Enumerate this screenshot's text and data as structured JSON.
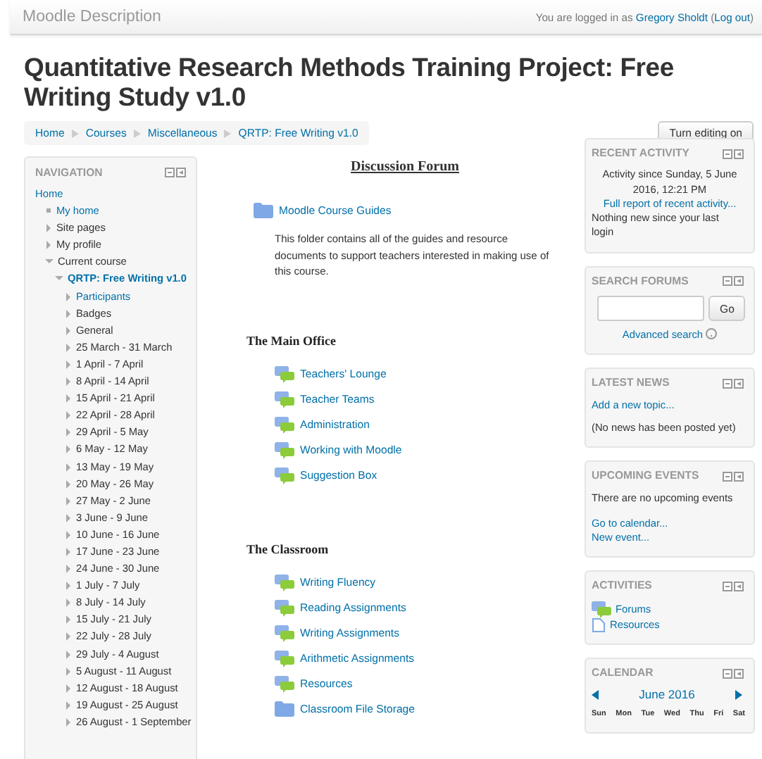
{
  "header": {
    "site_name": "Moodle Description",
    "login": {
      "before": "You are logged in as ",
      "user": "Gregory Sholdt",
      "middle": " (",
      "logout": "Log out",
      "after": ")"
    }
  },
  "title": "Quantitative Research Methods Training Project: Free Writing Study v1.0",
  "breadcrumb": [
    "Home",
    "Courses",
    "Miscellaneous",
    "QRTP: Free Writing v1.0"
  ],
  "edit_button": "Turn editing on",
  "navigation": {
    "title": "NAVIGATION",
    "items": [
      {
        "label": "Home",
        "link": true,
        "selected": false,
        "children": [
          {
            "label": "My home",
            "kind": "leaf",
            "link": true,
            "selected": false
          },
          {
            "label": "Site pages",
            "kind": "branch",
            "expanded": false,
            "link": false,
            "selected": false
          },
          {
            "label": "My profile",
            "kind": "branch",
            "expanded": false,
            "link": false,
            "selected": false
          },
          {
            "label": "Current course",
            "kind": "branch",
            "expanded": true,
            "link": false,
            "selected": false,
            "children": [
              {
                "label": "QRTP: Free Writing v1.0",
                "kind": "branch",
                "expanded": true,
                "link": true,
                "selected": true,
                "children": [
                  {
                    "label": "Participants",
                    "kind": "branch",
                    "expanded": false,
                    "link": true,
                    "selected": false
                  },
                  {
                    "label": "Badges",
                    "kind": "branch",
                    "expanded": false,
                    "link": false,
                    "selected": false
                  },
                  {
                    "label": "General",
                    "kind": "branch",
                    "expanded": false,
                    "link": false,
                    "selected": false
                  },
                  {
                    "label": "25 March - 31 March",
                    "kind": "branch",
                    "expanded": false,
                    "link": false,
                    "selected": false
                  },
                  {
                    "label": "1 April - 7 April",
                    "kind": "branch",
                    "expanded": false,
                    "link": false,
                    "selected": false
                  },
                  {
                    "label": "8 April - 14 April",
                    "kind": "branch",
                    "expanded": false,
                    "link": false,
                    "selected": false
                  },
                  {
                    "label": "15 April - 21 April",
                    "kind": "branch",
                    "expanded": false,
                    "link": false,
                    "selected": false
                  },
                  {
                    "label": "22 April - 28 April",
                    "kind": "branch",
                    "expanded": false,
                    "link": false,
                    "selected": false
                  },
                  {
                    "label": "29 April - 5 May",
                    "kind": "branch",
                    "expanded": false,
                    "link": false,
                    "selected": false
                  },
                  {
                    "label": "6 May - 12 May",
                    "kind": "branch",
                    "expanded": false,
                    "link": false,
                    "selected": false
                  },
                  {
                    "label": "13 May - 19 May",
                    "kind": "branch",
                    "expanded": false,
                    "link": false,
                    "selected": false
                  },
                  {
                    "label": "20 May - 26 May",
                    "kind": "branch",
                    "expanded": false,
                    "link": false,
                    "selected": false
                  },
                  {
                    "label": "27 May - 2 June",
                    "kind": "branch",
                    "expanded": false,
                    "link": false,
                    "selected": false
                  },
                  {
                    "label": "3 June - 9 June",
                    "kind": "branch",
                    "expanded": false,
                    "link": false,
                    "selected": false
                  },
                  {
                    "label": "10 June - 16 June",
                    "kind": "branch",
                    "expanded": false,
                    "link": false,
                    "selected": false
                  },
                  {
                    "label": "17 June - 23 June",
                    "kind": "branch",
                    "expanded": false,
                    "link": false,
                    "selected": false
                  },
                  {
                    "label": "24 June - 30 June",
                    "kind": "branch",
                    "expanded": false,
                    "link": false,
                    "selected": false
                  },
                  {
                    "label": "1 July - 7 July",
                    "kind": "branch",
                    "expanded": false,
                    "link": false,
                    "selected": false
                  },
                  {
                    "label": "8 July - 14 July",
                    "kind": "branch",
                    "expanded": false,
                    "link": false,
                    "selected": false
                  },
                  {
                    "label": "15 July - 21 July",
                    "kind": "branch",
                    "expanded": false,
                    "link": false,
                    "selected": false
                  },
                  {
                    "label": "22 July - 28 July",
                    "kind": "branch",
                    "expanded": false,
                    "link": false,
                    "selected": false
                  },
                  {
                    "label": "29 July - 4 August",
                    "kind": "branch",
                    "expanded": false,
                    "link": false,
                    "selected": false
                  },
                  {
                    "label": "5 August - 11 August",
                    "kind": "branch",
                    "expanded": false,
                    "link": false,
                    "selected": false
                  },
                  {
                    "label": "12 August - 18 August",
                    "kind": "branch",
                    "expanded": false,
                    "link": false,
                    "selected": false
                  },
                  {
                    "label": "19 August - 25 August",
                    "kind": "branch",
                    "expanded": false,
                    "link": false,
                    "selected": false
                  },
                  {
                    "label": "26 August - 1 September",
                    "kind": "branch",
                    "expanded": false,
                    "link": false,
                    "selected": false
                  }
                ]
              }
            ]
          }
        ]
      }
    ]
  },
  "sections": [
    {
      "heading": "Discussion Forum",
      "kind": "banner",
      "items": [
        {
          "label": "Moodle Course Guides",
          "kind": "folder"
        }
      ],
      "description": "This folder contains all of the guides and resource documents to support teachers interested in making use of this course."
    },
    {
      "heading": "The Main Office",
      "kind": "plain",
      "items": [
        {
          "label": "Teachers' Lounge",
          "kind": "forum"
        },
        {
          "label": "Teacher Teams",
          "kind": "forum"
        },
        {
          "label": "Administration",
          "kind": "forum"
        },
        {
          "label": "Working with Moodle",
          "kind": "forum"
        },
        {
          "label": "Suggestion Box",
          "kind": "forum"
        }
      ]
    },
    {
      "heading": "The Classroom",
      "kind": "plain",
      "items": [
        {
          "label": "Writing Fluency",
          "kind": "forum"
        },
        {
          "label": "Reading Assignments",
          "kind": "forum"
        },
        {
          "label": "Writing Assignments",
          "kind": "forum"
        },
        {
          "label": "Arithmetic Assignments",
          "kind": "forum"
        },
        {
          "label": "Resources",
          "kind": "forum"
        },
        {
          "label": "Classroom File Storage",
          "kind": "folder"
        }
      ]
    }
  ],
  "blocks": [
    {
      "kind": "recent",
      "title": "RECENT ACTIVITY",
      "since": "Activity since Sunday, 5 June 2016, 12:21 PM",
      "link": "Full report of recent activity...",
      "note": "Nothing new since your last login"
    },
    {
      "kind": "search",
      "title": "SEARCH FORUMS",
      "button": "Go",
      "link": "Advanced search"
    },
    {
      "kind": "news",
      "title": "LATEST NEWS",
      "link": "Add a new topic...",
      "note": "(No news has been posted yet)"
    },
    {
      "kind": "events",
      "title": "UPCOMING EVENTS",
      "note": "There are no upcoming events",
      "links": [
        "Go to calendar...",
        "New event..."
      ]
    },
    {
      "kind": "activities",
      "title": "ACTIVITIES",
      "items": [
        {
          "label": "Forums",
          "kind": "forum"
        },
        {
          "label": "Resources",
          "kind": "file"
        }
      ]
    },
    {
      "kind": "calendar",
      "title": "CALENDAR",
      "month": "June 2016",
      "weekdays": [
        "Sun",
        "Mon",
        "Tue",
        "Wed",
        "Thu",
        "Fri",
        "Sat"
      ]
    }
  ]
}
